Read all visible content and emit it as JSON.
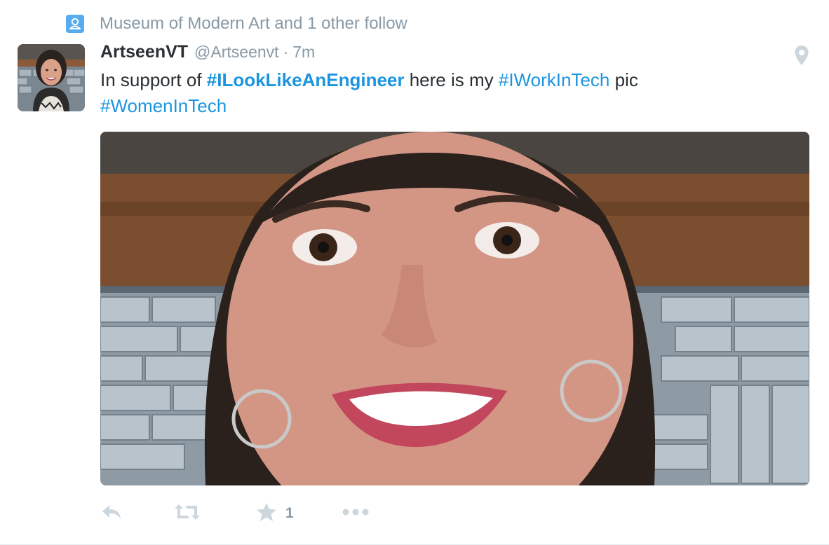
{
  "context": {
    "icon": "person-follow-icon",
    "text": "Museum of Modern Art and 1 other follow",
    "icon_color": "#55acee"
  },
  "tweet": {
    "author_name": "ArtseenVT",
    "author_handle": "@Artseenvt",
    "separator": "·",
    "timestamp": "7m",
    "text_parts": {
      "p1": "In support of ",
      "tag1": "#ILookLikeAnEngineer",
      "p2": " here is my ",
      "tag2": "#IWorkInTech",
      "p3": " pic",
      "tag3": "#WomenInTech"
    },
    "location_icon": "map-pin-icon",
    "avatar_icon": "avatar-photo",
    "media_icon": "selfie-photo"
  },
  "actions": {
    "reply": {
      "icon": "reply-icon"
    },
    "retweet": {
      "icon": "retweet-icon"
    },
    "favorite": {
      "icon": "star-icon",
      "count": "1"
    },
    "more": {
      "icon": "more-dots-icon"
    }
  },
  "colors": {
    "link": "#1b95e0",
    "text": "#292f33",
    "muted": "#8899a6",
    "action_icon": "#ccd6dd"
  }
}
